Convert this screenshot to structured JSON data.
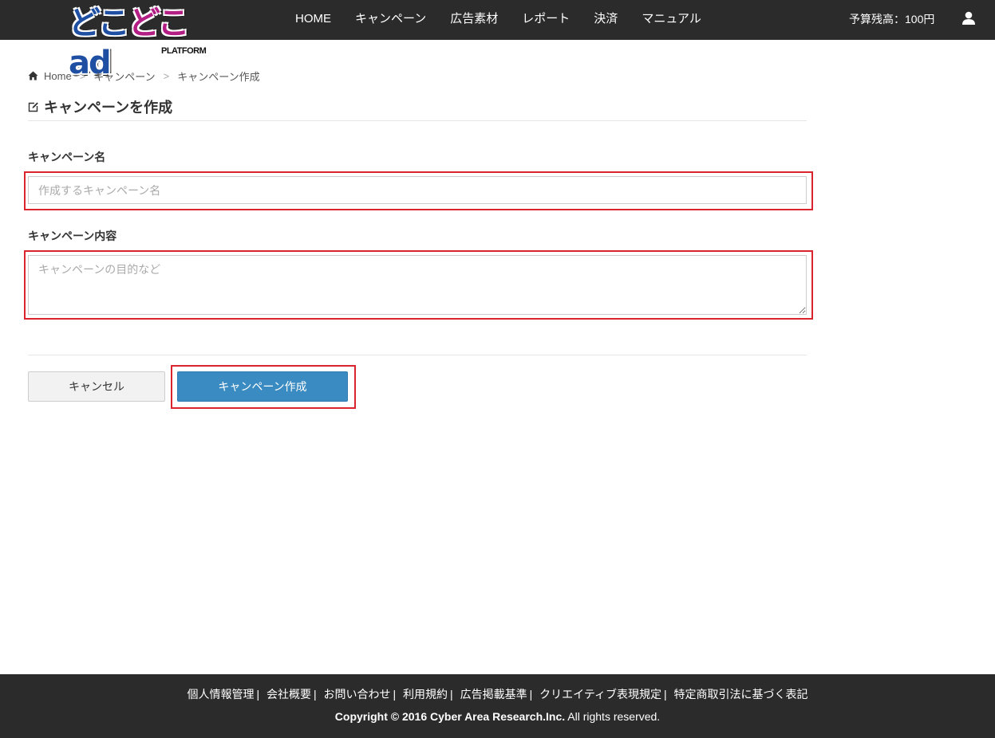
{
  "header": {
    "logo": {
      "main_part1": "どこ",
      "main_part2": "どこ",
      "main_part3": "ad",
      "sub": "PLATFORM"
    },
    "nav": [
      "HOME",
      "キャンペーン",
      "広告素材",
      "レポート",
      "決済",
      "マニュアル"
    ],
    "budget": "予算残高：100円",
    "icons": {
      "user": "user-icon"
    }
  },
  "breadcrumb": {
    "items": [
      "Home",
      "キャンペーン",
      "キャンペーン作成"
    ],
    "separator": ">",
    "icons": {
      "home": "home-icon"
    }
  },
  "page": {
    "title": "キャンペーンを作成",
    "icons": {
      "title": "edit-icon"
    }
  },
  "form": {
    "name_label": "キャンペーン名",
    "name_placeholder": "作成するキャンペーン名",
    "name_value": "",
    "description_label": "キャンペーン内容",
    "description_placeholder": "キャンペーンの目的など",
    "description_value": "",
    "cancel_label": "キャンセル",
    "submit_label": "キャンペーン作成"
  },
  "footer": {
    "links": [
      "個人情報管理",
      "会社概要",
      "お問い合わせ",
      "利用規約",
      "広告掲載基準",
      "クリエイティブ表現規定",
      "特定商取引法に基づく表記"
    ],
    "separator": "|",
    "copyright_bold": "Copyright © 2016 Cyber Area Research.Inc.",
    "copyright_rest": "All rights reserved."
  },
  "colors": {
    "header_bg": "#2b2b2b",
    "highlight": "#d9232e",
    "primary_button": "#3a8bc1",
    "logo_blue": "#1f4fa3",
    "logo_pink": "#b21e84"
  }
}
